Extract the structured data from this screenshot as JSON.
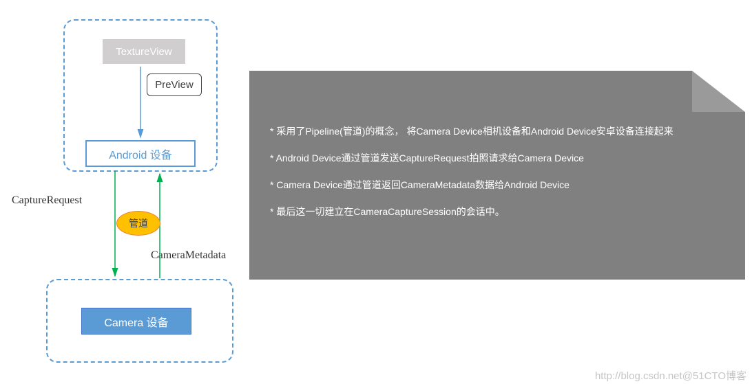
{
  "diagram": {
    "textureView": "TextureView",
    "preview": "PreView",
    "androidDevice": "Android 设备",
    "cameraDevice": "Camera 设备",
    "pipe": "管道",
    "captureRequest": "CaptureRequest",
    "cameraMetadata": "CameraMetadata"
  },
  "notes": {
    "bullet1": "* 采用了Pipeline(管道)的概念， 将Camera Device相机设备和Android Device安卓设备连接起来",
    "bullet2": "* Android Device通过管道发送CaptureRequest拍照请求给Camera Device",
    "bullet3": "* Camera Device通过管道返回CameraMetadata数据给Android Device",
    "bullet4": "* 最后这一切建立在CameraCaptureSession的会话中。"
  },
  "watermark": "http://blog.csdn.net@51CTO博客"
}
